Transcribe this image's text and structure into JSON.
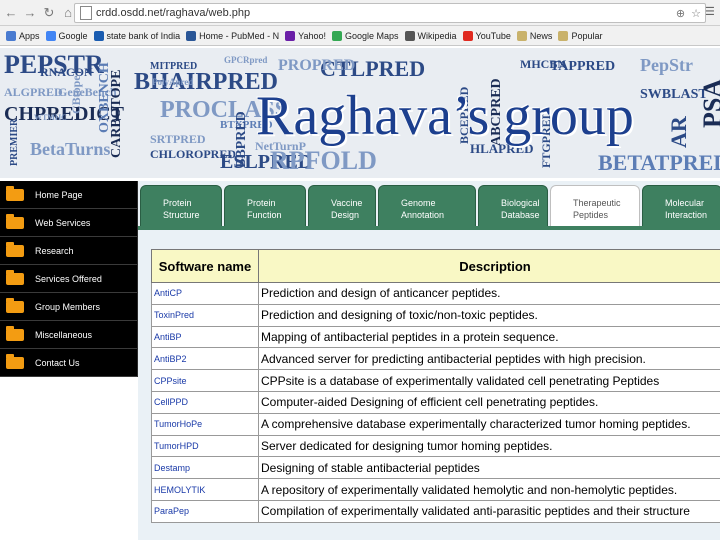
{
  "browser": {
    "url": "crdd.osdd.net/raghava/web.php",
    "bookmarks": [
      {
        "label": "Apps",
        "icon": "apps-icon",
        "color": "#4a7bd0"
      },
      {
        "label": "Google",
        "icon": "google-icon",
        "color": "#4285f4"
      },
      {
        "label": "state bank of India",
        "icon": "sbi-icon",
        "color": "#1a5cb0"
      },
      {
        "label": "Home - PubMed - N",
        "icon": "pubmed-icon",
        "color": "#2b5797"
      },
      {
        "label": "Yahoo!",
        "icon": "yahoo-icon",
        "color": "#6b1fa7"
      },
      {
        "label": "Google Maps",
        "icon": "maps-icon",
        "color": "#34a853"
      },
      {
        "label": "Wikipedia",
        "icon": "wikipedia-icon",
        "color": "#555555"
      },
      {
        "label": "YouTube",
        "icon": "youtube-icon",
        "color": "#e02a20"
      },
      {
        "label": "News",
        "icon": "folder-icon",
        "color": "#c9b26b"
      },
      {
        "label": "Popular",
        "icon": "folder-icon",
        "color": "#c9b26b"
      }
    ]
  },
  "banner": {
    "title": "Raghava’s group",
    "words": [
      {
        "t": "PEPSTR",
        "c": "n"
      },
      {
        "t": "ALGPRED",
        "c": "l"
      },
      {
        "t": "GeneBench",
        "c": "l"
      },
      {
        "t": "CHPREDICT",
        "c": "d"
      },
      {
        "t": "BetaTurns",
        "c": "l"
      },
      {
        "t": "CARBOTOPE",
        "c": "d"
      },
      {
        "t": "OXBENCH",
        "c": "s"
      },
      {
        "t": "BHAIRPRED",
        "c": "n"
      },
      {
        "t": "PROCLASS",
        "c": "l"
      },
      {
        "t": "SRTPRED",
        "c": "l"
      },
      {
        "t": "CHLOROPRED",
        "c": "n"
      },
      {
        "t": "BTXPRED",
        "c": "s"
      },
      {
        "t": "ESLPRED",
        "c": "n"
      },
      {
        "t": "CTLPRED",
        "c": "n"
      },
      {
        "t": "PROPRED",
        "c": "l"
      },
      {
        "t": "RPFOLD",
        "c": "l"
      },
      {
        "t": "HLAPRED",
        "c": "n"
      },
      {
        "t": "BCEPRED",
        "c": "n"
      },
      {
        "t": "ABCPRED",
        "c": "d"
      },
      {
        "t": "TAPPRED",
        "c": "n"
      },
      {
        "t": "PepStr",
        "c": "l"
      },
      {
        "t": "BETATPRED",
        "c": "s"
      },
      {
        "t": "SWBLAST",
        "c": "n"
      },
      {
        "t": "PSA",
        "c": "d"
      },
      {
        "t": "MHCBN",
        "c": "n"
      },
      {
        "t": "AR",
        "c": "n"
      },
      {
        "t": "GPCRpred",
        "c": "l"
      },
      {
        "t": "MITPRED",
        "c": "n"
      },
      {
        "t": "WTMHC",
        "c": "l"
      },
      {
        "t": "RNACON",
        "c": "n"
      },
      {
        "t": "PREMIER",
        "c": "n"
      },
      {
        "t": "NetTurnP",
        "c": "l"
      },
      {
        "t": "CBtope",
        "c": "l"
      },
      {
        "t": "BBPRED",
        "c": "n"
      },
      {
        "t": "FTGPRED",
        "c": "n"
      },
      {
        "t": "PolyApred",
        "c": "l"
      }
    ]
  },
  "sidebar": {
    "items": [
      {
        "label": "Home Page"
      },
      {
        "label": "Web Services"
      },
      {
        "label": "Research"
      },
      {
        "label": "Services Offered"
      },
      {
        "label": "Group Members"
      },
      {
        "label": "Miscellaneous"
      },
      {
        "label": "Contact Us"
      }
    ]
  },
  "tabs": [
    {
      "label": "Protein\nStructure",
      "active": false
    },
    {
      "label": "Protein\nFunction",
      "active": false
    },
    {
      "label": "Vaccine\nDesign",
      "active": false
    },
    {
      "label": "Genome\nAnnotation",
      "active": false
    },
    {
      "label": "Biological\nDatabase",
      "active": false
    },
    {
      "label": "Therapeutic\nPeptides",
      "active": true
    },
    {
      "label": "Molecular\nInteraction",
      "active": false
    }
  ],
  "table": {
    "headers": [
      "Software name",
      "Description"
    ],
    "rows": [
      {
        "name": "AntiCP",
        "desc": "Prediction and design of anticancer peptides."
      },
      {
        "name": "ToxinPred",
        "desc": "Prediction and designing of toxic/non-toxic peptides."
      },
      {
        "name": "AntiBP",
        "desc": "Mapping of antibacterial peptides in a protein sequence."
      },
      {
        "name": "AntiBP2",
        "desc": "Advanced server for predicting antibacterial peptides with high precision."
      },
      {
        "name": "CPPsite",
        "desc": "CPPsite is a database of experimentally validated cell penetrating Peptides"
      },
      {
        "name": "CellPPD",
        "desc": "Computer-aided Designing of efficient cell penetrating peptides."
      },
      {
        "name": "TumorHoPe",
        "desc": "A comprehensive database experimentally characterized tumor homing peptides."
      },
      {
        "name": "TumorHPD",
        "desc": "Server dedicated for designing tumor homing peptides."
      },
      {
        "name": "Destamp",
        "desc": "Designing of stable antibacterial peptides"
      },
      {
        "name": "HEMOLYTIK",
        "desc": "A repository of experimentally validated hemolytic and non-hemolytic peptides."
      },
      {
        "name": "ParaPep",
        "desc": "Compilation of experimentally validated anti-parasitic peptides and their structure"
      }
    ]
  }
}
